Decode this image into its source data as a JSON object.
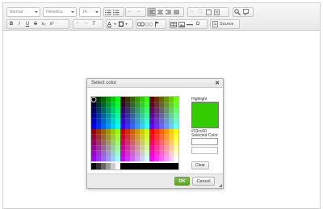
{
  "toolbar": {
    "format_combo": "Normal",
    "font_combo": "Helvetica",
    "size_combo": "14",
    "row1_groups": [
      [
        "list-numbered-icon",
        "list-bulleted-icon",
        "outdent-icon",
        "indent-icon"
      ],
      [
        "align-left-icon",
        "align-center-icon",
        "align-right-icon",
        "align-justify-icon"
      ],
      [
        "cut-icon",
        "copy-icon",
        "paste-icon",
        "paste-text-icon"
      ],
      [
        "find-icon",
        "spellcheck-icon"
      ]
    ],
    "row2": {
      "bold": "B",
      "italic": "I",
      "underline": "U",
      "strike": "S",
      "subscript": "x₂",
      "superscript": "x²",
      "source_label": "Source"
    },
    "row2_icons": [
      "undo-icon",
      "redo-icon",
      "remove-format-icon",
      "text-color-icon",
      "background-color-icon",
      "link-icon",
      "unlink-icon",
      "anchor-icon",
      "table-icon",
      "image-icon",
      "horizontal-rule-icon",
      "special-char-icon",
      "source-icon"
    ]
  },
  "dialog": {
    "title": "Select color",
    "close_glyph": "✖",
    "highlight_label": "Highlight",
    "highlight_color": "#33cc00",
    "highlight_hex": "#33cc00",
    "selected_label": "Selected Color",
    "selected_value": "",
    "clear_label": "Clear",
    "ok_label": "OK",
    "cancel_label": "Cancel"
  },
  "colors": {
    "ok_green": "#5aa321",
    "dialog_border": "#a9a9a9",
    "toolbar_bg": "#ececec"
  }
}
